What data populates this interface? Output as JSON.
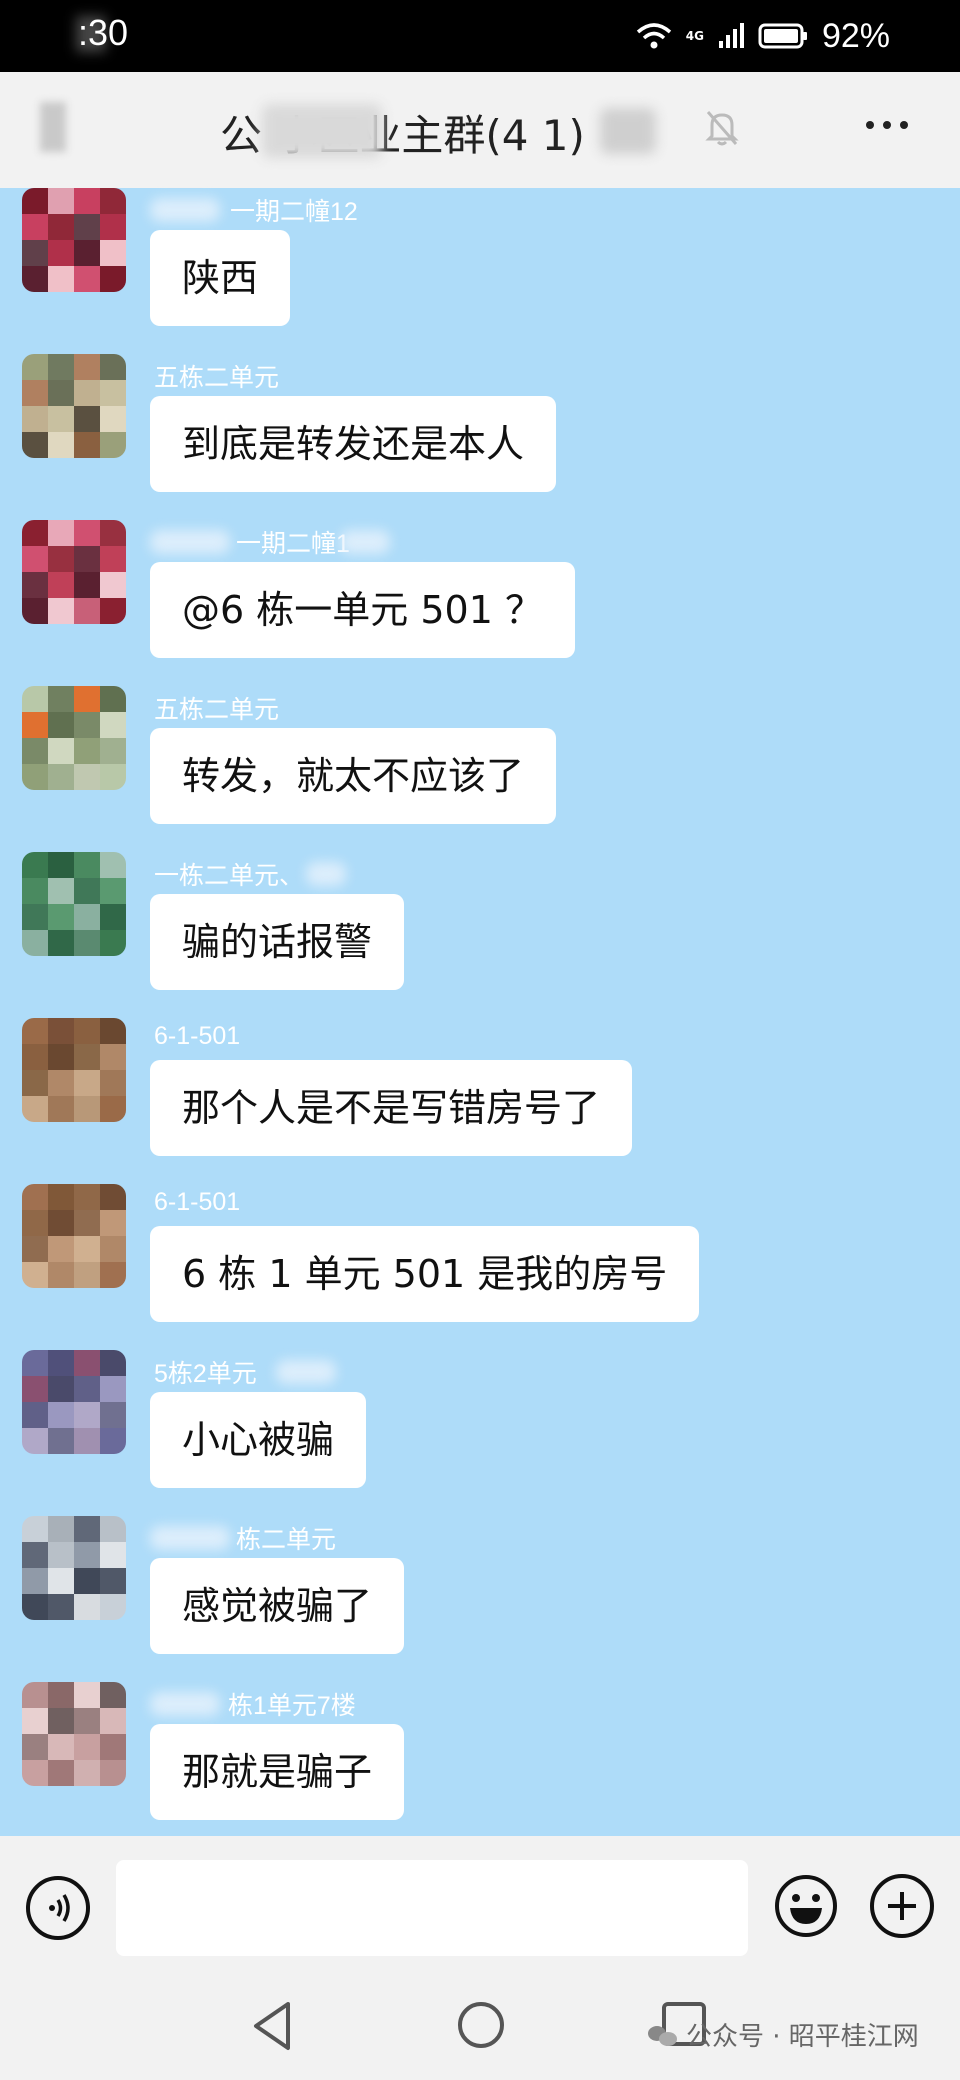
{
  "status_bar": {
    "time": ":30",
    "network": "4G",
    "battery_percent": "92%"
  },
  "header": {
    "title": "公  小区业主群(4 1)",
    "mute_icon": "bell-off-icon",
    "more_icon": "more-dots-icon"
  },
  "messages": [
    {
      "sender": "一期二幢12",
      "text": "陕西",
      "avatar_colors": [
        "#7a1a2a",
        "#b0304a",
        "#e0a0b0",
        "#5a2030",
        "#c84060",
        "#f0c0c8",
        "#902838",
        "#d05070",
        "#60404a"
      ]
    },
    {
      "sender": "五栋二单元",
      "text": "到底是转发还是本人",
      "avatar_colors": [
        "#9aa07a",
        "#c8c0a0",
        "#707a60",
        "#5a5040",
        "#b08060",
        "#e0d8c0",
        "#6a7058",
        "#8a6040",
        "#c0b090"
      ]
    },
    {
      "sender": "一期二幢1",
      "text": "@6 栋一单元 501 ？",
      "avatar_colors": [
        "#8a2030",
        "#c04058",
        "#e8a8b8",
        "#5a2030",
        "#d05070",
        "#f0c8d0",
        "#983040",
        "#c86078",
        "#6a3040"
      ]
    },
    {
      "sender": "五栋二单元",
      "text": "转发，就太不应该了",
      "avatar_colors": [
        "#b8c8a8",
        "#d0d8c0",
        "#708060",
        "#90a078",
        "#e07030",
        "#a0b090",
        "#607050",
        "#c0c8b0",
        "#7a8a68"
      ]
    },
    {
      "sender": "一栋二单元、",
      "text": "骗的话报警",
      "avatar_colors": [
        "#3a7a50",
        "#5a9a70",
        "#2a6040",
        "#8ab0a0",
        "#4a8a60",
        "#306848",
        "#a0c0b0",
        "#5a8a70",
        "#407858"
      ]
    },
    {
      "sender": "6-1-501",
      "text": "那个人是不是写错房号了",
      "avatar_colors": [
        "#9a6a48",
        "#b08868",
        "#7a5038",
        "#c8a888",
        "#8a6040",
        "#a07858",
        "#6a4830",
        "#b89878",
        "#8a6848"
      ]
    },
    {
      "sender": "6-1-501",
      "text": "6 栋 1 单元 501 是我的房号",
      "avatar_colors": [
        "#a07050",
        "#c09878",
        "#805838",
        "#d0b090",
        "#906848",
        "#b08868",
        "#704c34",
        "#c0a080",
        "#906c50"
      ]
    },
    {
      "sender": "5栋2单元",
      "text": "小心被骗",
      "avatar_colors": [
        "#6a6a9a",
        "#9a98c0",
        "#50507a",
        "#b0a8c8",
        "#8a5070",
        "#707090",
        "#4a4a6a",
        "#a090b0",
        "#606088"
      ]
    },
    {
      "sender": "栋二单元",
      "text": "感觉被骗了",
      "avatar_colors": [
        "#c8d0d8",
        "#e0e4e8",
        "#a8b0b8",
        "#404858",
        "#606878",
        "#505868",
        "#b8c0c8",
        "#d8dce0",
        "#909aa8"
      ]
    },
    {
      "sender": "栋1单元7楼",
      "text": "那就是骗子",
      "avatar_colors": [
        "#b89090",
        "#d8b8b8",
        "#8a6868",
        "#c8a0a0",
        "#e8d0d0",
        "#a07878",
        "#706060",
        "#d0b0b0",
        "#9a8080"
      ]
    }
  ],
  "input_bar": {
    "placeholder": "",
    "voice_icon": "voice-icon",
    "emoji_icon": "emoji-icon",
    "plus_icon": "plus-icon"
  },
  "nav_bar": {
    "back_icon": "nav-back-icon",
    "home_icon": "nav-home-icon",
    "recent_icon": "nav-recent-icon"
  },
  "watermark": "公众号 · 昭平桂江网",
  "colors": {
    "chat_background": "#aedcf9",
    "bubble": "#ffffff",
    "header": "#f2f2f2",
    "status_bar": "#000000"
  }
}
